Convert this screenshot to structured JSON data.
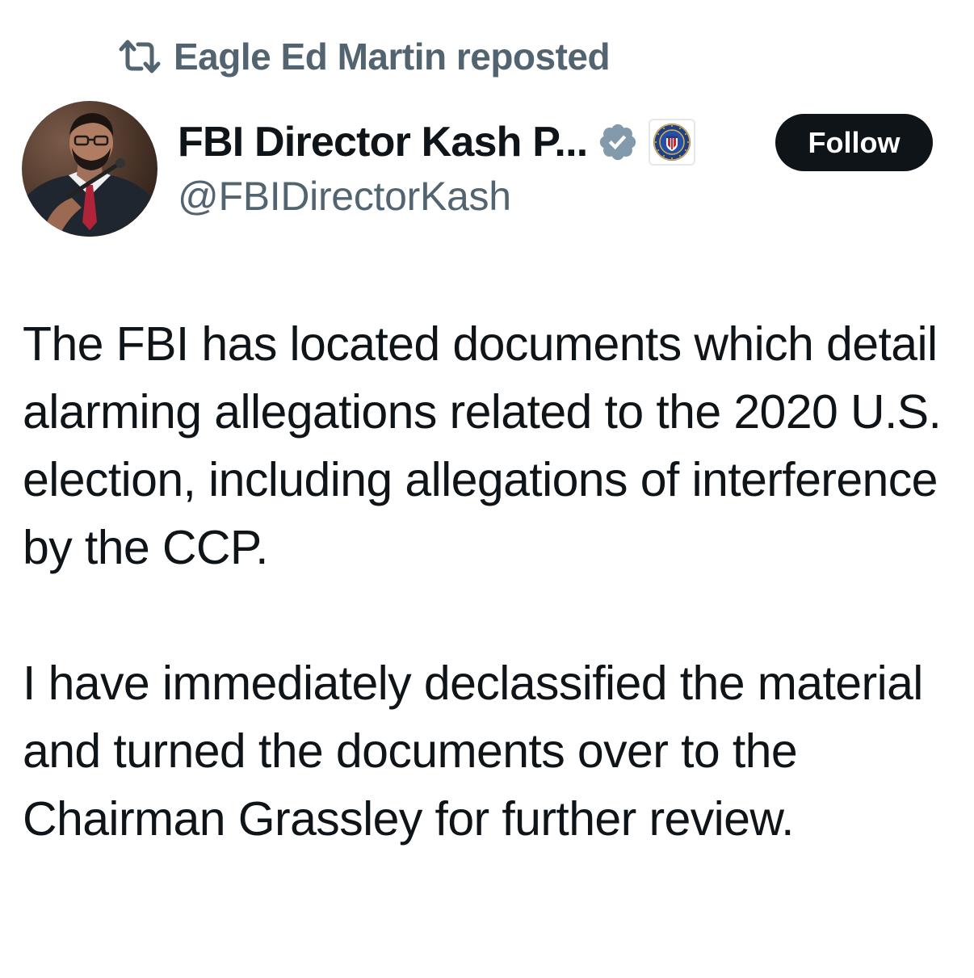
{
  "repost": {
    "icon": "repost-icon",
    "text": "Eagle Ed Martin reposted"
  },
  "author": {
    "display_name": "FBI Director Kash P...",
    "handle": "@FBIDirectorKash",
    "verified_icon": "verified-badge-icon",
    "affiliate_icon": "fbi-seal-icon",
    "avatar": "profile-photo"
  },
  "follow_button": {
    "label": "Follow"
  },
  "tweet": {
    "paragraphs": [
      "The FBI has located documents which detail alarming allegations related to the 2020 U.S. election, including allegations of interference by the CCP.",
      "I have immediately declassified the material and turned the documents over to the Chairman Grassley for further review."
    ]
  },
  "colors": {
    "text_primary": "#0f1419",
    "text_secondary": "#536471",
    "verified_badge": "#829aab",
    "follow_bg": "#0f1419",
    "follow_text": "#ffffff",
    "background": "#ffffff"
  }
}
